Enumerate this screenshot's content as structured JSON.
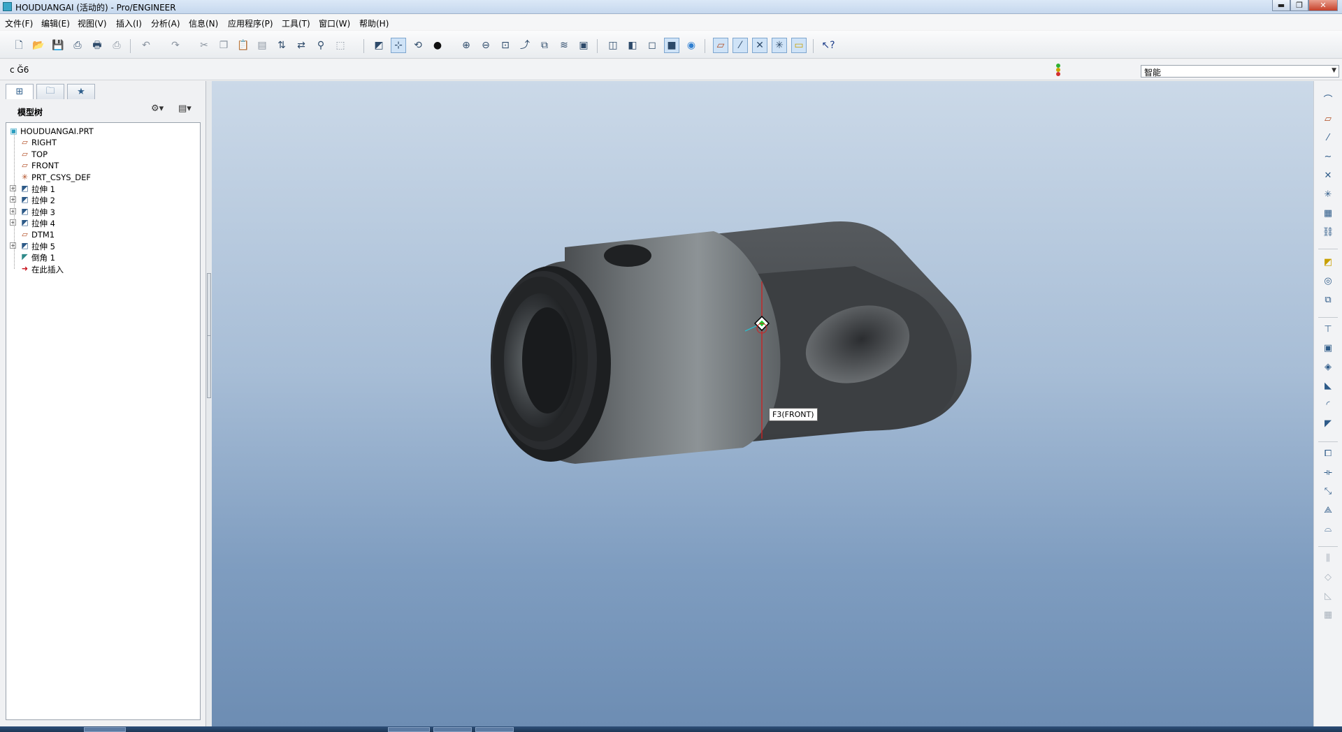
{
  "window": {
    "title": "HOUDUANGAI (活动的) - Pro/ENGINEER",
    "min_label": "▬",
    "max_label": "❐",
    "close_label": "✕"
  },
  "menu": [
    "文件(F)",
    "编辑(E)",
    "视图(V)",
    "插入(I)",
    "分析(A)",
    "信息(N)",
    "应用程序(P)",
    "工具(T)",
    "窗口(W)",
    "帮助(H)"
  ],
  "toolbar_icons": [
    "new-icon",
    "open-icon",
    "save-icon",
    "print-icon",
    "print-preview-icon",
    "print-setup-icon",
    "undo-icon",
    "redo-icon",
    "cut-icon",
    "copy-icon",
    "paste-icon",
    "paste-special-icon",
    "regenerate-icon",
    "regen-manager-icon",
    "find-icon",
    "select-box-icon",
    "repaint-icon",
    "spin-center-icon",
    "orient-mode-icon",
    "appearance-icon",
    "zoom-in-icon",
    "zoom-out-icon",
    "refit-icon",
    "reorient-icon",
    "saved-views-icon",
    "layers-icon",
    "view-manager-icon",
    "wireframe-icon",
    "hidden-line-icon",
    "no-hidden-icon",
    "shading-icon",
    "enhanced-realism-icon",
    "datum-plane-display-icon",
    "datum-axis-display-icon",
    "datum-point-display-icon",
    "csys-display-icon",
    "annotation-display-icon",
    "context-help-icon"
  ],
  "status": {
    "message": "c Ğ6",
    "filter_value": "智能",
    "light_colors": [
      "#2fb030",
      "#c9a300",
      "#d22f2f"
    ]
  },
  "left_panel": {
    "title": "模型树",
    "tabs": [
      "model-tree-tab-icon",
      "folder-browser-tab-icon",
      "favorites-tab-icon"
    ],
    "settings_icon": "tree-settings-icon",
    "show_icon": "tree-show-icon"
  },
  "tree": [
    {
      "label": "HOUDUANGAI.PRT",
      "icon": "part-icon",
      "level": 0,
      "expandable": false
    },
    {
      "label": "RIGHT",
      "icon": "datum-plane-icon",
      "level": 1,
      "expandable": false
    },
    {
      "label": "TOP",
      "icon": "datum-plane-icon",
      "level": 1,
      "expandable": false
    },
    {
      "label": "FRONT",
      "icon": "datum-plane-icon",
      "level": 1,
      "expandable": false
    },
    {
      "label": "PRT_CSYS_DEF",
      "icon": "csys-icon",
      "level": 1,
      "expandable": false
    },
    {
      "label": "拉伸 1",
      "icon": "extrude-icon",
      "level": 1,
      "expandable": true
    },
    {
      "label": "拉伸 2",
      "icon": "extrude-icon",
      "level": 1,
      "expandable": true
    },
    {
      "label": "拉伸 3",
      "icon": "extrude-icon",
      "level": 1,
      "expandable": true
    },
    {
      "label": "拉伸 4",
      "icon": "extrude-icon",
      "level": 1,
      "expandable": true
    },
    {
      "label": "DTM1",
      "icon": "datum-plane-icon",
      "level": 1,
      "expandable": false
    },
    {
      "label": "拉伸 5",
      "icon": "extrude-icon",
      "level": 1,
      "expandable": true
    },
    {
      "label": "倒角 1",
      "icon": "chamfer-icon",
      "level": 1,
      "expandable": false
    },
    {
      "label": "在此插入",
      "icon": "insert-here-arrow-icon",
      "level": 1,
      "expandable": false
    }
  ],
  "graphics": {
    "tooltip": "F3(FRONT)"
  },
  "right_icons": [
    "sketch-tool-icon",
    "datum-plane-tool-icon",
    "datum-axis-tool-icon",
    "datum-curve-tool-icon",
    "datum-point-tool-icon",
    "csys-tool-icon",
    "analysis-tool-icon",
    "reference-tool-icon",
    "extrude-tool-icon",
    "revolve-tool-icon",
    "variable-sweep-icon",
    "hole-tool-icon",
    "shell-tool-icon",
    "rib-tool-icon",
    "draft-tool-icon",
    "round-tool-icon",
    "chamfer-tool-icon",
    "copy-feature-icon",
    "mirror-tool-icon",
    "pattern-tool-icon",
    "merge-tool-icon",
    "trim-tool-icon",
    "intersect-icon",
    "offset-icon",
    "thicken-icon",
    "solidify-icon"
  ]
}
